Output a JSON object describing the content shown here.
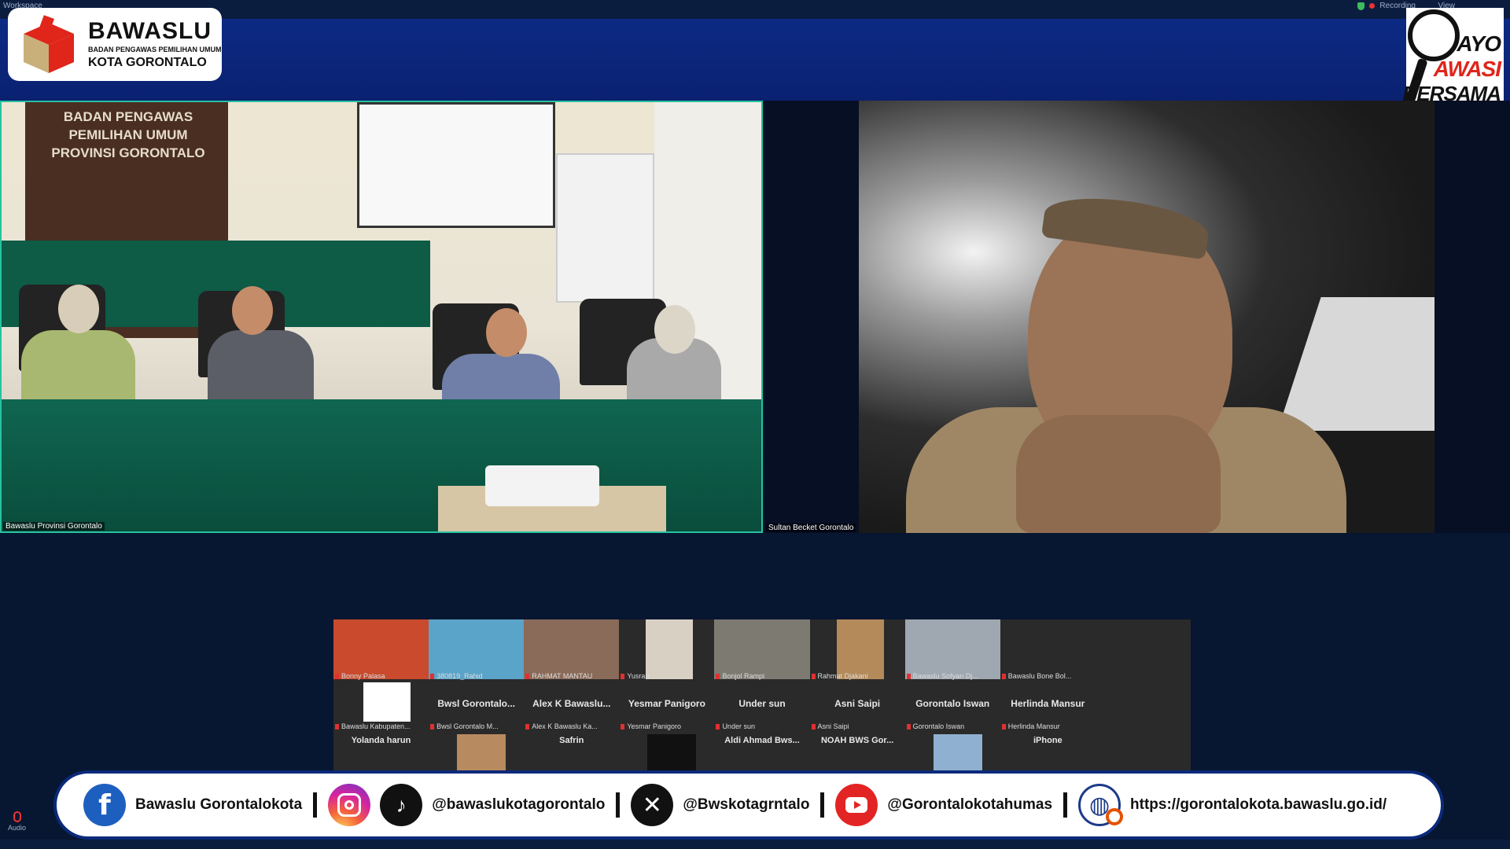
{
  "window": {
    "top_left_label": "Workspace",
    "recording_label": "Recording",
    "view_label": "View"
  },
  "header": {
    "logo_name": "BAWASLU",
    "logo_subtitle": "BADAN PENGAWAS PEMILIHAN UMUM",
    "logo_city": "KOTA GORONTALO",
    "badge_line1": "AYO",
    "badge_line2": "AWASI",
    "badge_line3": "BERSAMA"
  },
  "main_video": {
    "wall_sign_line1": "BADAN PENGAWAS PEMILIHAN UMUM",
    "wall_sign_line2": "PROVINSI GORONTALO",
    "participant_name": "Bawaslu Provinsi Gorontalo"
  },
  "second_video": {
    "participant_name": "Sultan Becket Gorontalo"
  },
  "gallery": {
    "row1": [
      {
        "label": "Bonny Palasa",
        "thumb": "#c94a2c"
      },
      {
        "label": "380819_Rahid",
        "thumb": "#5aa3c9"
      },
      {
        "label": "RAHMAT MANTAU",
        "thumb": "#8a6a58"
      },
      {
        "label": "Yusran",
        "thumb": "#d9d0c4"
      },
      {
        "label": "Bonjol Rampi",
        "thumb": "#7d7a72"
      },
      {
        "label": "Rahmat Djakani",
        "thumb": "#b58a5a"
      },
      {
        "label": "Bawaslu Sofyan Dj...",
        "thumb": "#9fa7b0"
      },
      {
        "label": "Bawaslu Bone Bol...",
        "thumb": "#2a2a2a"
      },
      {
        "label": "",
        "thumb": "#2a2a2a"
      }
    ],
    "row2": [
      {
        "name": "",
        "label": "Bawaslu Kabupaten..."
      },
      {
        "name": "Bwsl Gorontalo...",
        "label": "Bwsl Gorontalo M..."
      },
      {
        "name": "Alex K Bawaslu...",
        "label": "Alex K Bawaslu Ka..."
      },
      {
        "name": "Yesmar Panigoro",
        "label": "Yesmar Panigoro"
      },
      {
        "name": "Under sun",
        "label": "Under sun"
      },
      {
        "name": "Asni Saipi",
        "label": "Asni Saipi"
      },
      {
        "name": "Gorontalo Iswan",
        "label": "Gorontalo Iswan"
      },
      {
        "name": "Herlinda Mansur",
        "label": "Herlinda Mansur"
      },
      {
        "name": "",
        "label": ""
      }
    ],
    "row3": [
      {
        "name": "Yolanda harun"
      },
      {
        "name": ""
      },
      {
        "name": "Safrin"
      },
      {
        "name": ""
      },
      {
        "name": "Aldi Ahmad Bws..."
      },
      {
        "name": "NOAH BWS Gor..."
      },
      {
        "name": ""
      },
      {
        "name": "iPhone"
      },
      {
        "name": ""
      }
    ]
  },
  "social": {
    "facebook": "Bawaslu Gorontalokota",
    "instagram_tiktok": "@bawaslukotagorontalo",
    "x": "@Bwskotagrntalo",
    "youtube": "@Gorontalokotahumas",
    "website": "https://gorontalokota.bawaslu.go.id/"
  },
  "footer": {
    "audio_label": "Audio"
  },
  "colors": {
    "background": "#071631",
    "header_band": "#0c2a84",
    "active_speaker_border": "#28c2a0",
    "brand_red": "#e0251b"
  }
}
